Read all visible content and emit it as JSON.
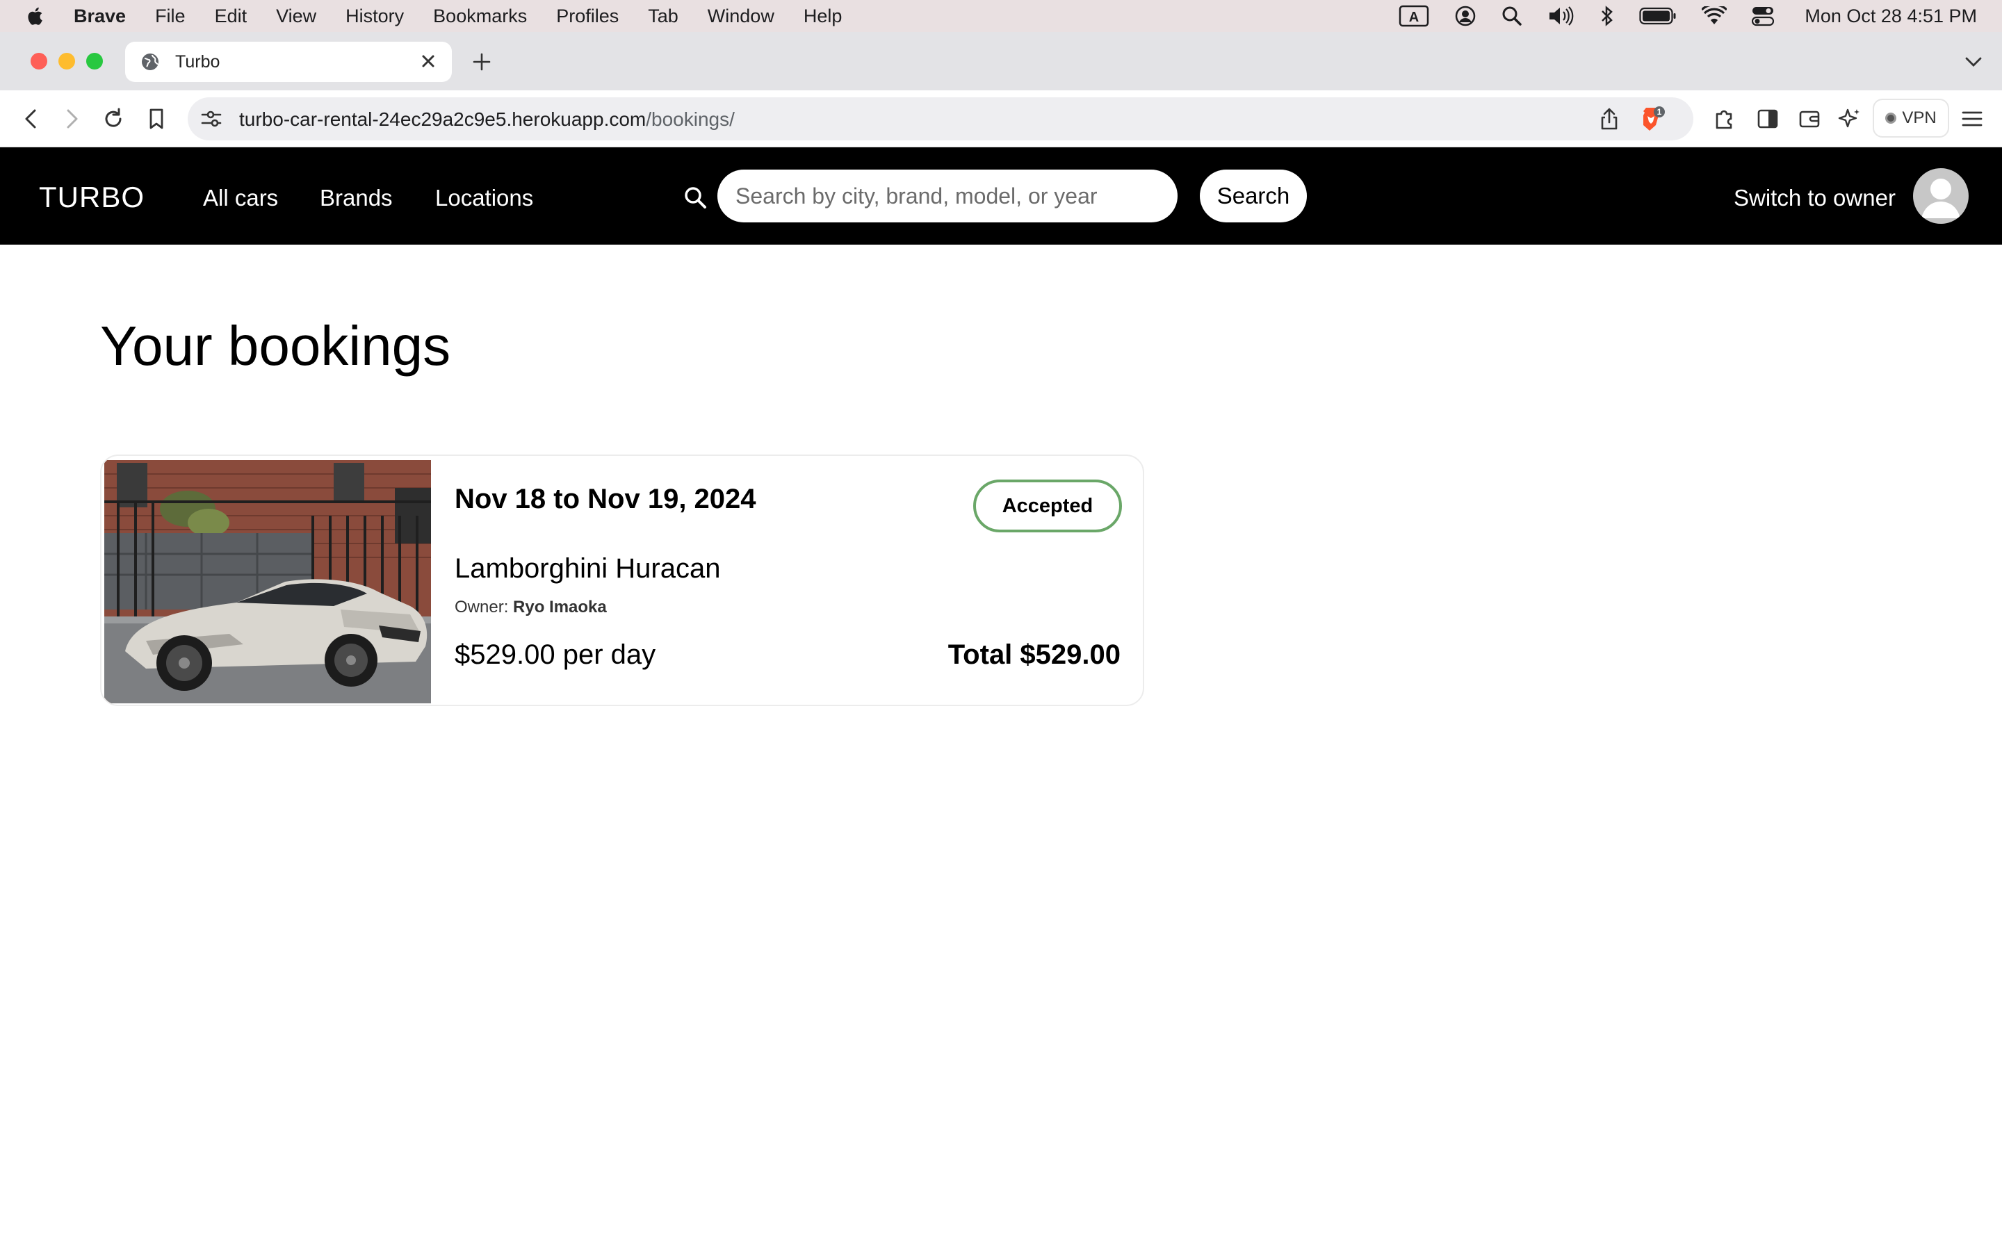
{
  "menubar": {
    "app_name": "Brave",
    "items": [
      "File",
      "Edit",
      "View",
      "History",
      "Bookmarks",
      "Profiles",
      "Tab",
      "Window",
      "Help"
    ],
    "clock": "Mon Oct 28  4:51 PM"
  },
  "browser": {
    "tab_title": "Turbo",
    "url_host": "turbo-car-rental-24ec29a2c9e5.herokuapp.com",
    "url_path": "/bookings/",
    "shields_count": "1",
    "vpn_label": "VPN"
  },
  "site": {
    "logo": "TURBO",
    "nav": [
      "All cars",
      "Brands",
      "Locations"
    ],
    "search_placeholder": "Search by city, brand, model, or year",
    "search_button": "Search",
    "switch_owner": "Switch to owner"
  },
  "page": {
    "title": "Your bookings",
    "bookings": [
      {
        "dates": "Nov 18 to Nov 19, 2024",
        "status": "Accepted",
        "status_color": "#6aa768",
        "car": "Lamborghini Huracan",
        "owner_label": "Owner:",
        "owner_name": "Ryo Imaoka",
        "price": "$529.00 per day",
        "total": "Total $529.00"
      }
    ]
  }
}
